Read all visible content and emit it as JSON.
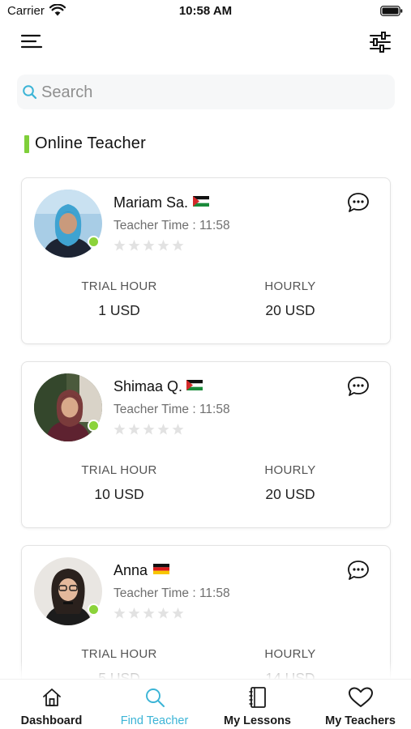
{
  "status_bar": {
    "carrier": "Carrier",
    "time": "10:58 AM"
  },
  "icons": {
    "menu": "menu-icon",
    "filter": "filter-sliders-icon",
    "search": "search-icon",
    "chat": "chat-bubble-icon",
    "star": "star-icon"
  },
  "search": {
    "placeholder": "Search",
    "value": ""
  },
  "section": {
    "title": "Online Teacher",
    "accent_color": "#7fcf3a"
  },
  "teachers": [
    {
      "name": "Mariam Sa.",
      "flag": "palestine-flag-icon",
      "time_label": "Teacher Time : 11:58",
      "rating": 0,
      "trial_label": "TRIAL HOUR",
      "trial_value": "1 USD",
      "hourly_label": "HOURLY",
      "hourly_value": "20 USD",
      "online": true
    },
    {
      "name": "Shimaa Q.",
      "flag": "palestine-flag-icon",
      "time_label": "Teacher Time : 11:58",
      "rating": 0,
      "trial_label": "TRIAL HOUR",
      "trial_value": "10 USD",
      "hourly_label": "HOURLY",
      "hourly_value": "20 USD",
      "online": true
    },
    {
      "name": "Anna",
      "flag": "germany-flag-icon",
      "time_label": "Teacher Time : 11:58",
      "rating": 0,
      "trial_label": "TRIAL HOUR",
      "trial_value": "5 USD",
      "hourly_label": "HOURLY",
      "hourly_value": "14 USD",
      "online": true
    }
  ],
  "tab_bar": {
    "active_color": "#3bb4d6",
    "tabs": [
      {
        "label": "Dashboard",
        "icon": "home-icon"
      },
      {
        "label": "Find Teacher",
        "icon": "search-icon",
        "active": true
      },
      {
        "label": "My Lessons",
        "icon": "notebook-icon"
      },
      {
        "label": "My Teachers",
        "icon": "heart-icon"
      }
    ]
  }
}
